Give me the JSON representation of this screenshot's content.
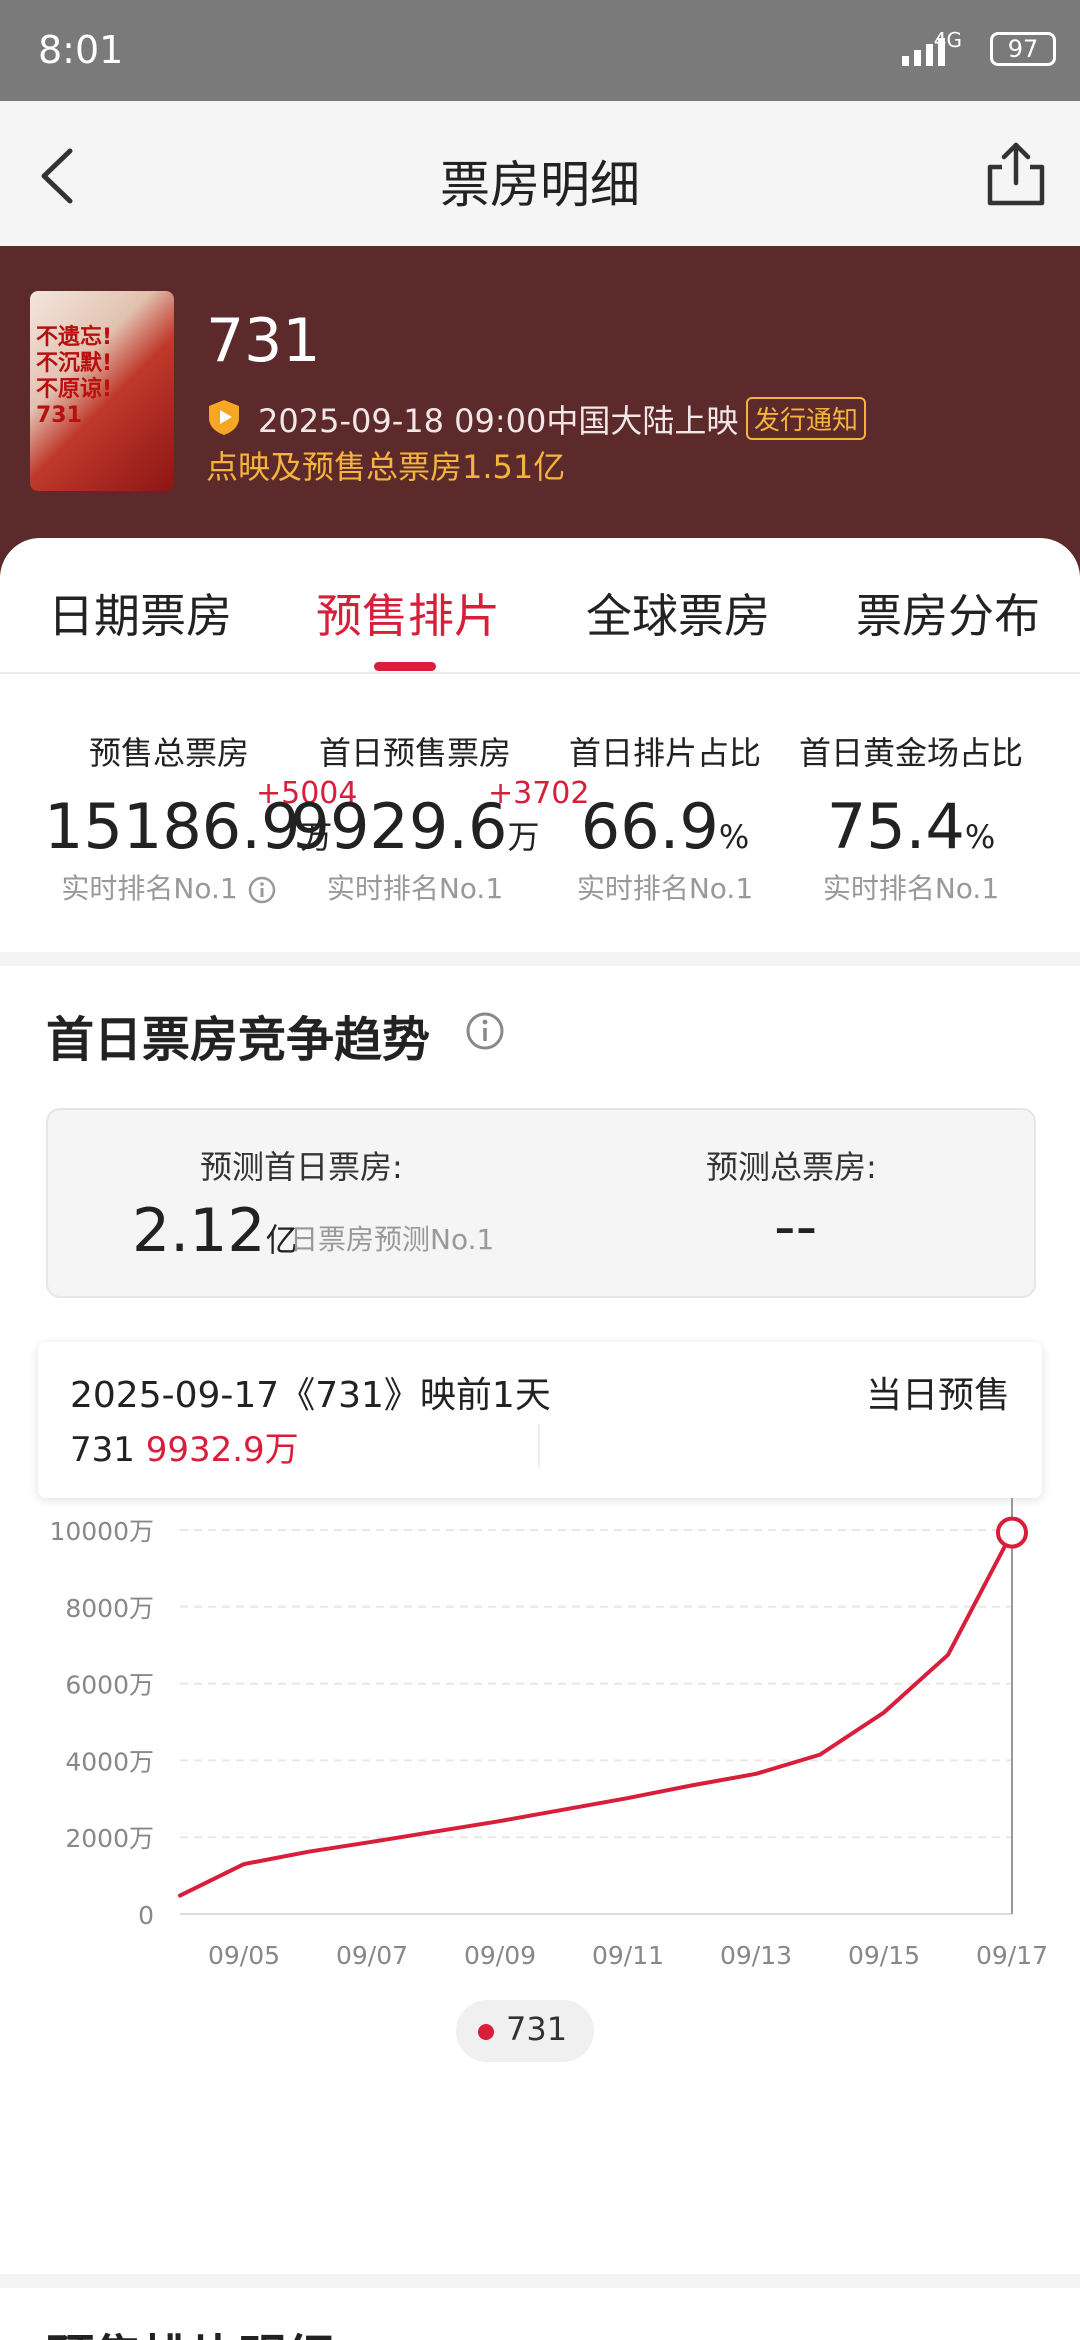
{
  "status_bar": {
    "time": "8:01",
    "network": "4G",
    "battery": "97"
  },
  "nav": {
    "title": "票房明细"
  },
  "movie": {
    "poster_text": "不遗忘!不沉默!不原谅!",
    "poster_number": "731",
    "title": "731",
    "release": "2025-09-18 09:00中国大陆上映",
    "notice_badge": "发行通知",
    "presale_total": "点映及预售总票房1.51亿"
  },
  "tabs": [
    "日期票房",
    "预售排片",
    "全球票房",
    "票房分布"
  ],
  "stats": [
    {
      "label": "预售总票房",
      "value": "15186.9",
      "unit": "万",
      "delta": "+5004",
      "rank": "实时排名No.1"
    },
    {
      "label": "首日预售票房",
      "value": "9929.6",
      "unit": "万",
      "delta": "+3702",
      "rank": "实时排名No.1"
    },
    {
      "label": "首日排片占比",
      "value": "66.9",
      "unit": "%",
      "rank": "实时排名No.1"
    },
    {
      "label": "首日黄金场占比",
      "value": "75.4",
      "unit": "%",
      "rank": "实时排名No.1"
    }
  ],
  "trend": {
    "title": "首日票房竞争趋势",
    "predict_first_day_label": "预测首日票房:",
    "predict_first_day_value": "2.12",
    "predict_first_day_unit": "亿",
    "predict_first_day_rank": "日票房预测No.1",
    "predict_total_label": "预测总票房:",
    "predict_total_value": "--"
  },
  "tooltip": {
    "date": "2025-09-17《731》映前1天",
    "kind": "当日预售",
    "series": "731",
    "amount": "9932.9万"
  },
  "chart_data": {
    "type": "line",
    "x": [
      "09/04",
      "09/05",
      "09/06",
      "09/07",
      "09/08",
      "09/09",
      "09/10",
      "09/11",
      "09/12",
      "09/13",
      "09/14",
      "09/15",
      "09/16",
      "09/17"
    ],
    "x_tick_labels": [
      "09/05",
      "09/07",
      "09/09",
      "09/11",
      "09/13",
      "09/15",
      "09/17"
    ],
    "y_tick_labels": [
      "0",
      "2000万",
      "4000万",
      "6000万",
      "8000万",
      "10000万"
    ],
    "ylim": [
      0,
      10000
    ],
    "y_unit": "万",
    "grid": true,
    "series": [
      {
        "name": "731",
        "color": "#d81e3a",
        "values": [
          480,
          1300,
          1620,
          1880,
          2150,
          2420,
          2720,
          3020,
          3350,
          3650,
          4150,
          5250,
          6750,
          9932.9
        ]
      }
    ],
    "highlight_index": 13
  },
  "colors": {
    "accent": "#d81e3a",
    "header_bg": "#5c2a2b",
    "gold": "#f5b23c"
  },
  "next_section": {
    "title": "预售排片明细"
  }
}
